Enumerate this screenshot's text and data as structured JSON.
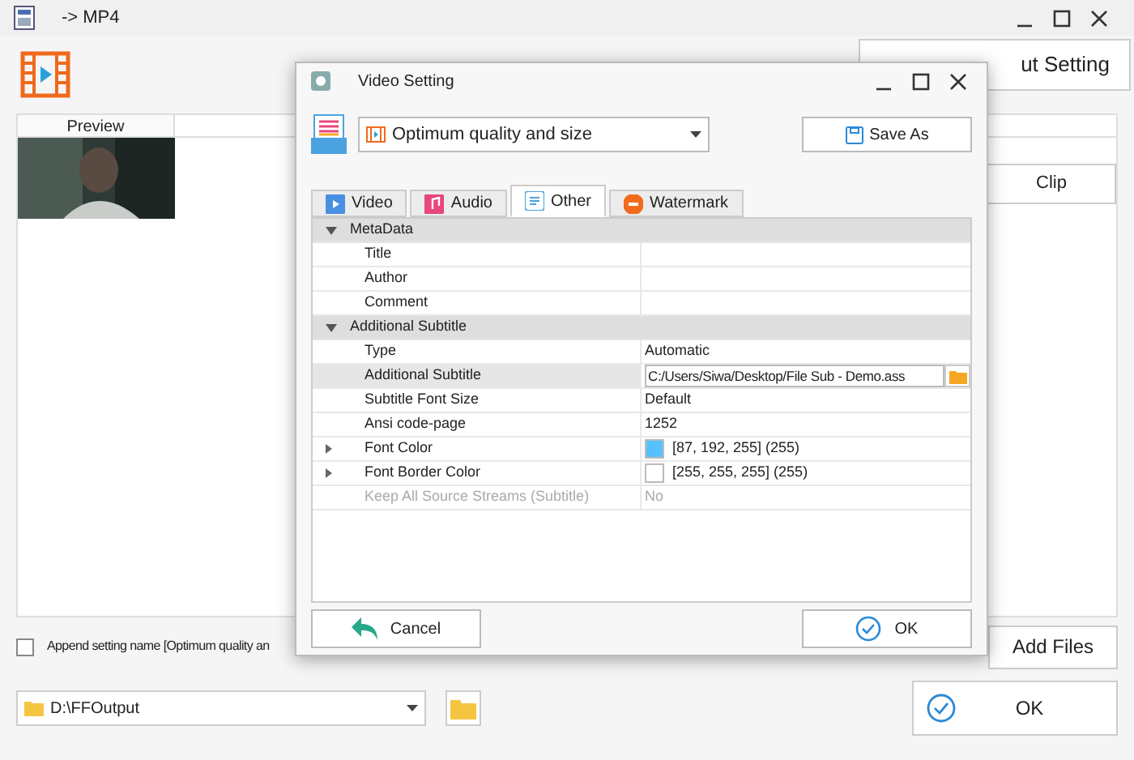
{
  "window": {
    "title": "-> MP4"
  },
  "output_setting_button": {
    "label": "ut Setting"
  },
  "file_list": {
    "columns": [
      "Preview"
    ],
    "rows": [
      {
        "kind": "picture"
      }
    ]
  },
  "clip_button": {
    "label": "Clip"
  },
  "append_setting": {
    "label": "Append setting name [Optimum quality an",
    "checked": false
  },
  "add_files_button": {
    "label": "Add Files"
  },
  "output_folder": {
    "value": "D:\\FFOutput"
  },
  "ok_button": {
    "label": "OK"
  },
  "dialog": {
    "title": "Video Setting",
    "profile": {
      "value": "Optimum quality and size"
    },
    "save_as_button": {
      "label": "Save As"
    },
    "tabs": [
      {
        "label": "Video",
        "selected": false
      },
      {
        "label": "Audio",
        "selected": false
      },
      {
        "label": "Other",
        "selected": true
      },
      {
        "label": "Watermark",
        "selected": false
      }
    ],
    "groups": [
      {
        "name": "MetaData",
        "expanded": true,
        "rows": [
          {
            "kind": "text",
            "label": "Title",
            "value": "",
            "selected": false,
            "disabled": false
          },
          {
            "kind": "text",
            "label": "Author",
            "value": "",
            "selected": false,
            "disabled": false
          },
          {
            "kind": "text",
            "label": "Comment",
            "value": "",
            "selected": false,
            "disabled": false
          }
        ]
      },
      {
        "name": "Additional Subtitle",
        "expanded": true,
        "rows": [
          {
            "kind": "text",
            "label": "Type",
            "value": "Automatic",
            "selected": false,
            "disabled": false
          },
          {
            "kind": "file",
            "label": "Additional Subtitle",
            "value": "C:/Users/Siwa/Desktop/File Sub - Demo.ass",
            "selected": true,
            "disabled": false
          },
          {
            "kind": "text",
            "label": "Subtitle Font Size",
            "value": "Default",
            "selected": false,
            "disabled": false
          },
          {
            "kind": "text",
            "label": "Ansi code-page",
            "value": "1252",
            "selected": false,
            "disabled": false
          },
          {
            "kind": "color",
            "label": "Font Color",
            "value": "[87, 192, 255] (255)",
            "color": "#57c0ff",
            "selected": false,
            "disabled": false
          },
          {
            "kind": "color",
            "label": "Font Border Color",
            "value": "[255, 255, 255] (255)",
            "color": "#ffffff",
            "selected": false,
            "disabled": false
          },
          {
            "kind": "text",
            "label": "Keep All Source Streams (Subtitle)",
            "value": "No",
            "selected": false,
            "disabled": true
          }
        ]
      }
    ],
    "cancel_button": {
      "label": "Cancel"
    },
    "ok_button": {
      "label": "OK"
    }
  }
}
